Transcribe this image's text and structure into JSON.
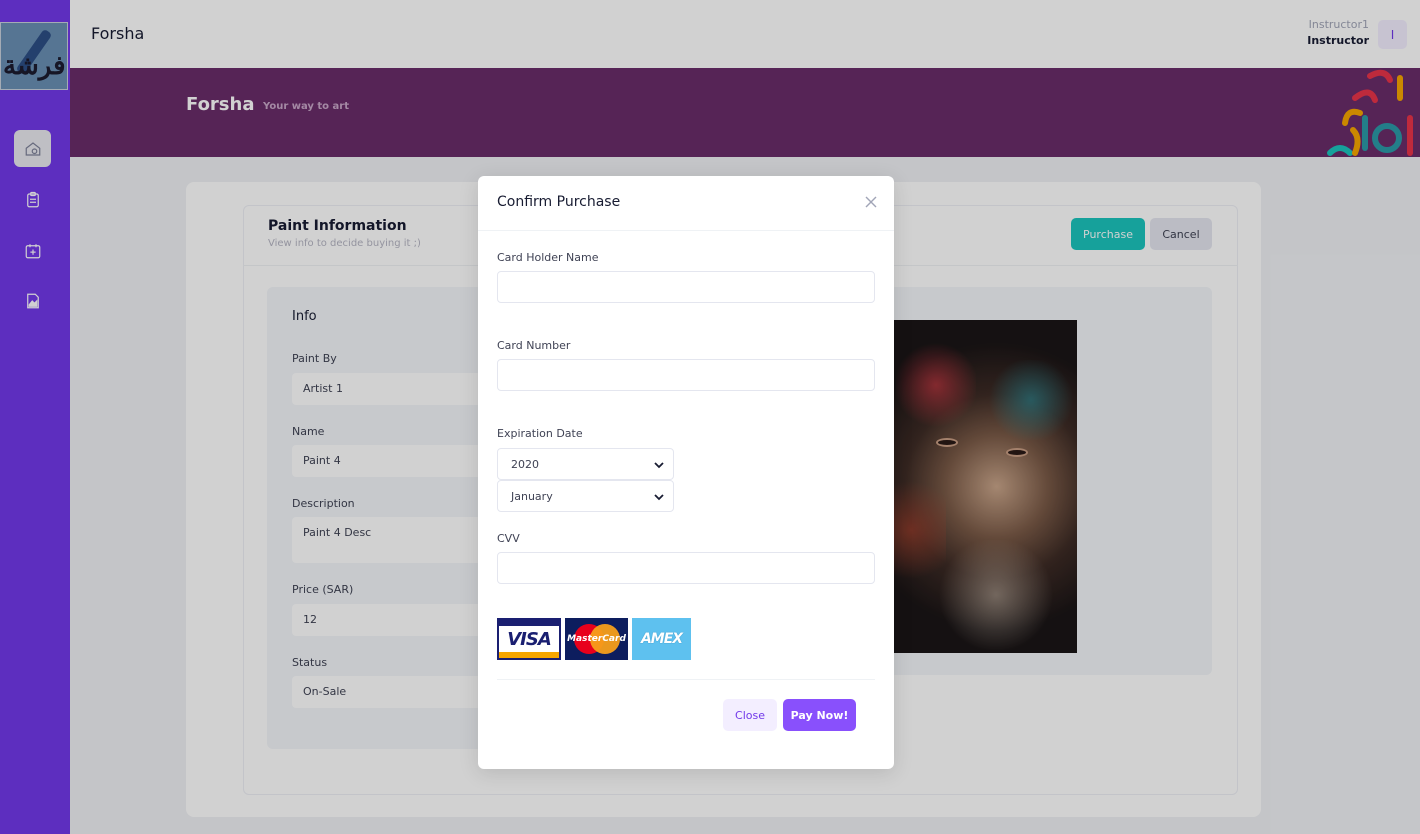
{
  "topbar": {
    "brand": "Forsha",
    "user_name": "Instructor1",
    "user_role": "Instructor",
    "avatar_initial": "I"
  },
  "sidebar": {
    "logo_text": "فرشة",
    "items": [
      {
        "icon": "home-icon",
        "active": true
      },
      {
        "icon": "clipboard-icon",
        "active": false
      },
      {
        "icon": "calendar-add-icon",
        "active": false
      },
      {
        "icon": "image-file-icon",
        "active": false
      }
    ]
  },
  "banner": {
    "title": "Forsha",
    "subtitle": "Your way to art"
  },
  "panel": {
    "title": "Paint Information",
    "subtitle": "View info to decide buying it ;)",
    "purchase_label": "Purchase",
    "cancel_label": "Cancel"
  },
  "info": {
    "title": "Info",
    "fields": [
      {
        "label": "Paint By",
        "value": "Artist 1"
      },
      {
        "label": "Name",
        "value": "Paint 4"
      },
      {
        "label": "Description",
        "value": "Paint 4 Desc"
      },
      {
        "label": "Price (SAR)",
        "value": "12"
      },
      {
        "label": "Status",
        "value": "On-Sale"
      }
    ]
  },
  "modal": {
    "title": "Confirm Purchase",
    "card_holder_label": "Card Holder Name",
    "card_holder_value": "",
    "card_number_label": "Card Number",
    "card_number_value": "",
    "expiration_label": "Expiration Date",
    "year_value": "2020",
    "month_value": "January",
    "cvv_label": "CVV",
    "cvv_value": "",
    "cards": [
      "VISA",
      "MasterCard",
      "AMEX"
    ],
    "close_label": "Close",
    "pay_label": "Pay Now!"
  },
  "colors": {
    "sidebar": "#7239ea",
    "banner": "#6a2c6a",
    "purchase": "#1bc5bd",
    "pay": "#8950fc"
  }
}
